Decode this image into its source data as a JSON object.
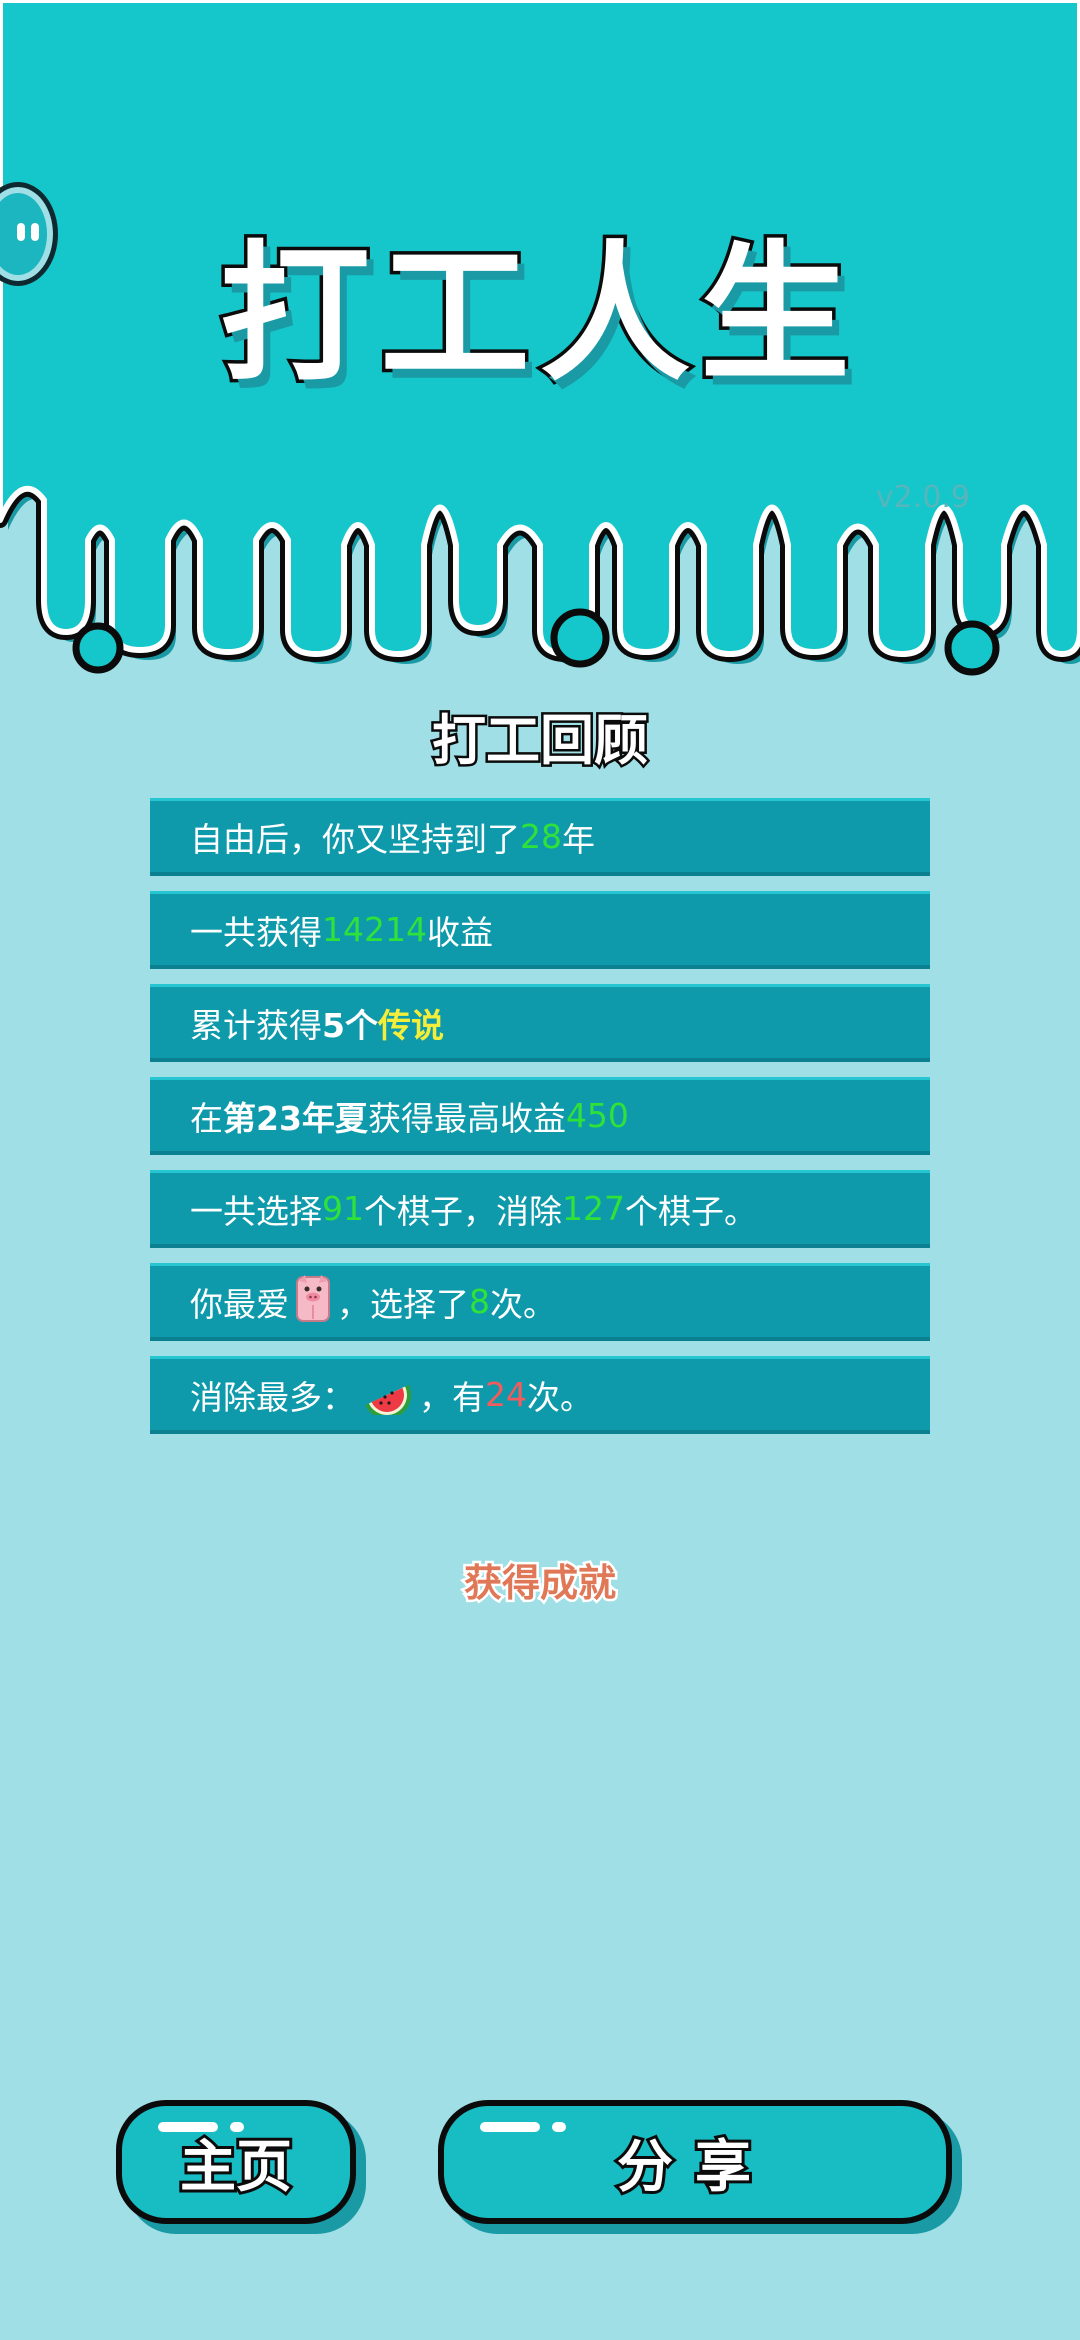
{
  "app": {
    "title": "打工人生",
    "version": "v2.0.9"
  },
  "review": {
    "title": "打工回顾",
    "rows": [
      {
        "pre": "自由后，你又坚持到了",
        "value": "28",
        "post": "年"
      },
      {
        "pre": "一共获得",
        "value": "14214",
        "post": "收益"
      },
      {
        "pre": "累计获得",
        "bold": "5个",
        "yellow": "传说"
      },
      {
        "pre": "在 ",
        "bold": "第23年夏",
        "mid": " 获得最高收益",
        "value": "450"
      },
      {
        "pre": "一共选择",
        "value": "91",
        "mid": "个棋子，消除",
        "value2": "127",
        "post": "个棋子。"
      },
      {
        "pre": "你最爱",
        "emoji": "pig",
        "mid": "，选择了",
        "value": "8",
        "post": "次。"
      },
      {
        "pre": "消除最多：",
        "emoji": "watermelon",
        "mid": "，有",
        "value": "24",
        "post": "次。"
      }
    ]
  },
  "achievement": {
    "label": "获得成就"
  },
  "buttons": {
    "home": "主页",
    "share": "分享"
  },
  "colors": {
    "header": "#15c6ca",
    "background": "#9fdfe5",
    "row": "#0e9aab",
    "highlight_green": "#2fe23a",
    "highlight_yellow": "#f3ee3a",
    "highlight_red": "#f25c5c"
  }
}
